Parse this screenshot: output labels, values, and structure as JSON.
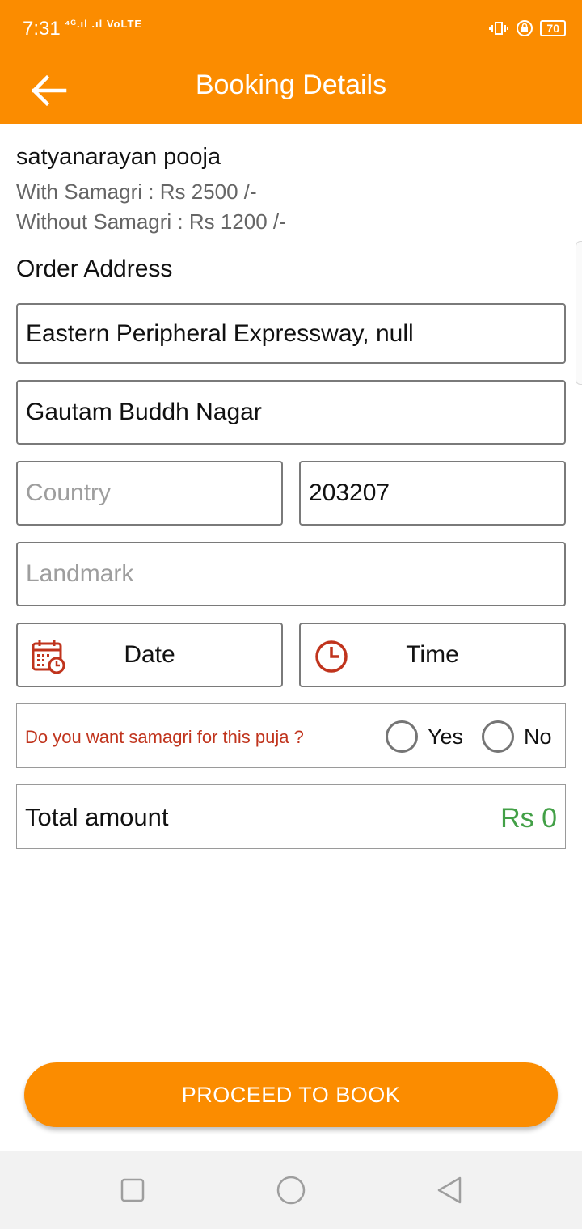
{
  "status_bar": {
    "time": "7:31",
    "network": "⁴ᴳ.ıl .ıl VoLTE",
    "battery": "70"
  },
  "header": {
    "title": "Booking Details",
    "back_icon": "arrow-left-icon"
  },
  "service": {
    "name": "satyanarayan pooja",
    "with_samagri": "With Samagri : Rs 2500 /-",
    "without_samagri": "Without Samagri : Rs 1200 /-"
  },
  "address": {
    "section_title": "Order Address",
    "street_value": "Eastern Peripheral Expressway, null",
    "city_value": "Gautam Buddh Nagar",
    "country_placeholder": "Country",
    "country_value": "",
    "pincode_value": "203207",
    "landmark_placeholder": "Landmark",
    "landmark_value": ""
  },
  "schedule": {
    "date_label": "Date",
    "date_icon": "calendar-icon",
    "time_label": "Time",
    "time_icon": "clock-icon"
  },
  "samagri": {
    "question": "Do you want samagri for this puja ?",
    "yes_label": "Yes",
    "no_label": "No"
  },
  "total": {
    "label": "Total amount",
    "value": "Rs 0"
  },
  "proceed_label": "PROCEED TO BOOK",
  "colors": {
    "primary": "#fb8c00",
    "question_text": "#c0341d",
    "icon_red": "#c0341d",
    "total_green": "#43a047"
  }
}
